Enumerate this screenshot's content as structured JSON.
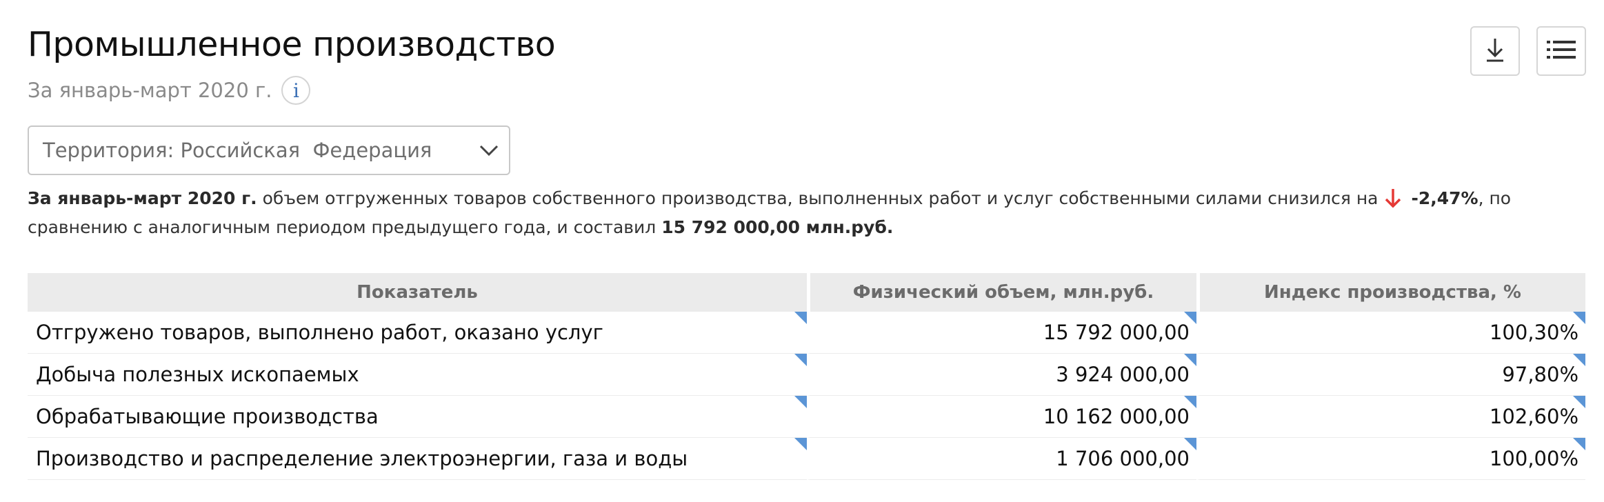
{
  "header": {
    "title": "Промышленное производство",
    "subtitle": "За январь-март 2020 г.",
    "info_icon": "info-icon"
  },
  "actions": {
    "download_icon": "download-icon",
    "list_icon": "list-icon"
  },
  "territory_select": {
    "value": "Территория: Российская  Федерация",
    "icon": "chevron-down-icon"
  },
  "summary": {
    "period_bold": "За январь-март 2020 г.",
    "text_1": " объем отгруженных товаров собственного производства, выполненных работ и услуг собственными силами снизился на",
    "change_value": "-2,47%",
    "text_2": ", по сравнению с аналогичным периодом предыдущего года, и составил ",
    "total_value": "15 792 000,00 млн.руб.",
    "trend_icon": "arrow-down-icon",
    "trend_color": "#e53935"
  },
  "table": {
    "headers": [
      "Показатель",
      "Физический объем, млн.руб.",
      "Индекс производства, %"
    ],
    "rows": [
      {
        "name": "Отгружено товаров, выполнено работ, оказано услуг",
        "volume": "15 792 000,00",
        "index": "100,30%"
      },
      {
        "name": "Добыча полезных ископаемых",
        "volume": "3 924 000,00",
        "index": "97,80%"
      },
      {
        "name": "Обрабатывающие производства",
        "volume": "10 162 000,00",
        "index": "102,60%"
      },
      {
        "name": "Производство и распределение электроэнергии, газа и воды",
        "volume": "1 706 000,00",
        "index": "100,00%"
      }
    ]
  },
  "colors": {
    "accent": "#5b95d6",
    "header_bg": "#ebebeb",
    "negative": "#e53935"
  }
}
